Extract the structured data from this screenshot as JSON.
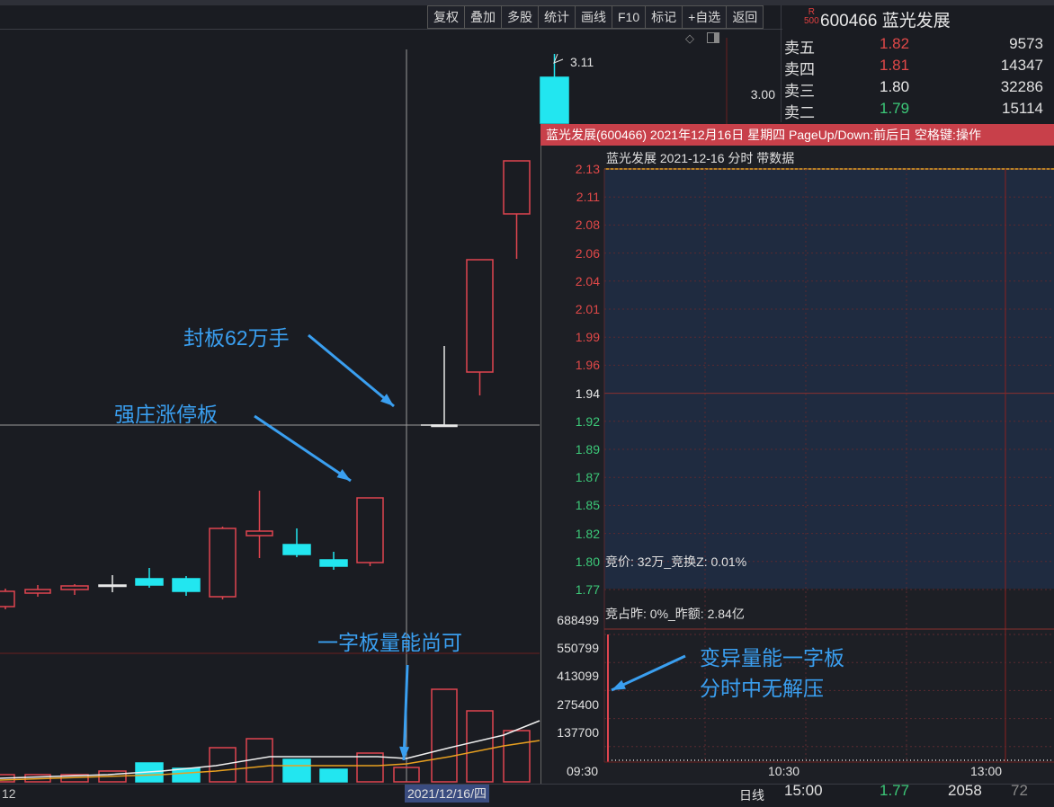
{
  "toolbar": {
    "buttons": [
      "复权",
      "叠加",
      "多股",
      "统计",
      "画线",
      "F10",
      "标记",
      "+自选",
      "返回"
    ]
  },
  "quote": {
    "badge_top": "R",
    "badge_bottom": "500",
    "code": "600466",
    "name": "蓝光发展",
    "order_book": [
      {
        "label": "卖五",
        "price": "1.82",
        "vol": "9573",
        "color": "#e04848"
      },
      {
        "label": "卖四",
        "price": "1.81",
        "vol": "14347",
        "color": "#e04848"
      },
      {
        "label": "卖三",
        "price": "1.80",
        "vol": "32286",
        "color": "#e8e8e8"
      },
      {
        "label": "卖二",
        "price": "1.79",
        "vol": "15114",
        "color": "#3cc878"
      }
    ],
    "tick": {
      "time": "15:00",
      "price": "1.77",
      "vol": "2058",
      "extra": "72"
    }
  },
  "chart": {
    "price_label_3": "3.00",
    "high_label": "3.11",
    "left_date_label": "12",
    "cursor_date": "2021/12/16/四",
    "period_label": "日线"
  },
  "annotations": {
    "a1": "封板62万手",
    "a2": "强庄涨停板",
    "a3": "一字板量能尚可",
    "a4_line1": "变异量能一字板",
    "a4_line2": "分时中无解压"
  },
  "popup": {
    "title": "蓝光发展(600466) 2021年12月16日 星期四 PageUp/Down:前后日 空格键:操作",
    "subtitle": "蓝光发展  2021-12-16 分时 带数据",
    "price_labels": [
      {
        "v": "2.13",
        "color": "#e04848"
      },
      {
        "v": "2.11",
        "color": "#e04848"
      },
      {
        "v": "2.08",
        "color": "#e04848"
      },
      {
        "v": "2.06",
        "color": "#e04848"
      },
      {
        "v": "2.04",
        "color": "#e04848"
      },
      {
        "v": "2.01",
        "color": "#e04848"
      },
      {
        "v": "1.99",
        "color": "#e04848"
      },
      {
        "v": "1.96",
        "color": "#e04848"
      },
      {
        "v": "1.94",
        "color": "#e8e8e8"
      },
      {
        "v": "1.92",
        "color": "#3cc878"
      },
      {
        "v": "1.89",
        "color": "#3cc878"
      },
      {
        "v": "1.87",
        "color": "#3cc878"
      },
      {
        "v": "1.85",
        "color": "#3cc878"
      },
      {
        "v": "1.82",
        "color": "#3cc878"
      },
      {
        "v": "1.80",
        "color": "#3cc878"
      },
      {
        "v": "1.77",
        "color": "#3cc878"
      }
    ],
    "auction_info": "竞价: 32万_竞换Z: 0.01%",
    "auction_ratio": "竞占昨: 0%_昨额: 2.84亿",
    "volume_labels": [
      "688499",
      "550799",
      "413099",
      "275400",
      "137700"
    ],
    "time_labels": [
      "09:30",
      "10:30",
      "13:00"
    ]
  }
}
